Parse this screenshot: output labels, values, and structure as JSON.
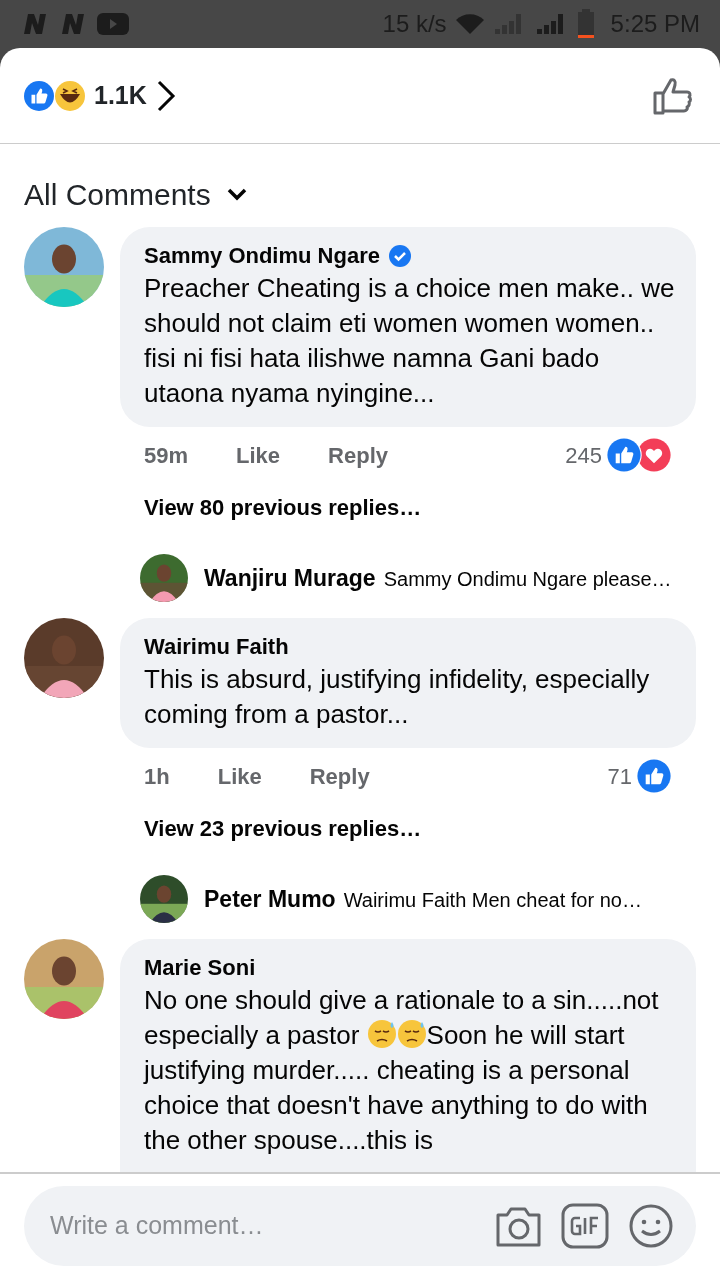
{
  "status_bar": {
    "speed": "15 k/s",
    "time": "5:25 PM"
  },
  "reactions_header": {
    "count": "1.1K"
  },
  "filter": {
    "label": "All Comments"
  },
  "comments": [
    {
      "author": "Sammy Ondimu Ngare",
      "verified": true,
      "text": [
        {
          "kind": "text",
          "value": "Preacher Cheating is a choice men make.. we should not claim eti women women women.. fisi ni fisi hata ilishwe namna Gani bado utaona nyama nyingine..."
        }
      ],
      "time": "59m",
      "like": "Like",
      "reply": "Reply",
      "reaction_count": "245",
      "reactions": [
        {
          "kind": "like"
        },
        {
          "kind": "love"
        }
      ],
      "replies_link": "View 80 previous replies…",
      "latest_reply": {
        "author": "Wanjiru Murage",
        "text": "Sammy Ondimu Ngare please…"
      }
    },
    {
      "author": "Wairimu Faith",
      "verified": false,
      "text": [
        {
          "kind": "text",
          "value": "This is absurd, justifying infidelity, especially coming from a pastor..."
        }
      ],
      "time": "1h",
      "like": "Like",
      "reply": "Reply",
      "reaction_count": "71",
      "reactions": [
        {
          "kind": "like"
        }
      ],
      "replies_link": "View 23 previous replies…",
      "latest_reply": {
        "author": "Peter Mumo",
        "text": "Wairimu Faith Men  cheat  for  no…"
      }
    },
    {
      "author": "Marie Soni",
      "verified": false,
      "text": [
        {
          "kind": "text",
          "value": "No one should give a rationale to a sin.....not especially a pastor "
        },
        {
          "kind": "emoji"
        },
        {
          "kind": "emoji"
        },
        {
          "kind": "text",
          "value": "Soon he will start justifying murder..... cheating is a personal choice that doesn't have anything to do with the other spouse....this is"
        }
      ]
    }
  ],
  "composer": {
    "placeholder": "Write a comment…"
  }
}
